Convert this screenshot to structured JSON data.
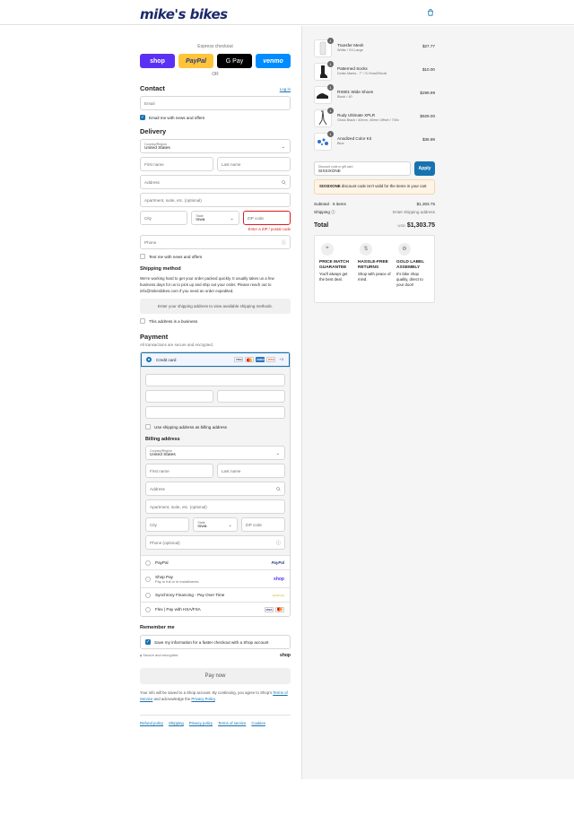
{
  "header": {
    "logo_text": "mike's bikes",
    "cart_icon": "shopping-bag-icon"
  },
  "express": {
    "title": "Express checkout",
    "buttons": [
      "shop",
      "PayPal",
      "G Pay",
      "venmo"
    ],
    "or_text": "OR"
  },
  "contact": {
    "title": "Contact",
    "login_label": "Log in",
    "email_placeholder": "Email",
    "news_label": "Email me with news and offers",
    "news_checked": true
  },
  "delivery": {
    "title": "Delivery",
    "country_label": "Country/Region",
    "country_value": "United States",
    "first_name_placeholder": "First name",
    "last_name_placeholder": "Last name",
    "address_placeholder": "Address",
    "apt_placeholder": "Apartment, suite, etc. (optional)",
    "city_placeholder": "City",
    "state_label": "State",
    "state_value": "Iowa",
    "zip_placeholder": "ZIP code",
    "zip_error": "Enter a ZIP / postal code",
    "phone_placeholder": "Phone",
    "text_label": "Text me with news and offers"
  },
  "shipping": {
    "title": "Shipping method",
    "message": "We're working hard to get your order packed quickly. It usually takes us a few business days for us to pick up and ship out your order. Please reach out to info@mikesbikes.com if you need an order expedited.",
    "placeholder_box": "Enter your shipping address to view available shipping methods.",
    "business_label": "This address is a business"
  },
  "payment": {
    "title": "Payment",
    "subtitle": "All transactions are secure and encrypted.",
    "credit_card_label": "Credit card",
    "card_brands": [
      "VISA",
      "MC",
      "AMEX",
      "DISC"
    ],
    "more_cards": "+3",
    "same_address_label": "Use shipping address as billing address",
    "billing_title": "Billing address",
    "billing": {
      "country_label": "Country/Region",
      "country_value": "United States",
      "first_name_placeholder": "First name",
      "last_name_placeholder": "Last name",
      "address_placeholder": "Address",
      "apt_placeholder": "Apartment, suite, etc. (optional)",
      "city_placeholder": "City",
      "state_label": "State",
      "state_value": "Iowa",
      "zip_placeholder": "ZIP code",
      "phone_placeholder": "Phone (optional)"
    },
    "methods": [
      {
        "label": "PayPal",
        "badge": "PayPal"
      },
      {
        "label": "Shop Pay",
        "sub": "Pay in full or in installments",
        "badge": "shop"
      },
      {
        "label": "Synchrony Financing - Pay Over Time",
        "badge": "synchrony"
      },
      {
        "label": "Flex | Pay with HSA/FSA",
        "badge": "VISA MC"
      }
    ]
  },
  "remember": {
    "title": "Remember me",
    "save_label": "Save my information for a faster checkout with a Shop account",
    "secure_text": "Secure and encrypted",
    "shop_text": "shop"
  },
  "pay_now_label": "Pay now",
  "fine_print": {
    "prefix": "Your info will be saved to a Shop account. By continuing, you agree to Shop's",
    "terms": "Terms of Service",
    "middle": "and acknowledge the",
    "privacy": "Privacy Policy",
    "suffix": "."
  },
  "footer_links": [
    "Refund policy",
    "Shipping",
    "Privacy policy",
    "Terms of service",
    "Cookies"
  ],
  "cart": {
    "items": [
      {
        "name": "Transfer Mesh",
        "variant": "White / XX-Large",
        "price": "$27.77",
        "qty": "1"
      },
      {
        "name": "Patterned Socks",
        "variant": "Dollar Marks - 7\" / S-Small/Small",
        "price": "$10.00",
        "qty": "1"
      },
      {
        "name": "RX801 Wide Shoes",
        "variant": "Black / 40",
        "price": "$299.99",
        "qty": "1"
      },
      {
        "name": "Rudy Ultimate XPLR",
        "variant": "Gloss Black / 40mm, 40mm Offset / 700c",
        "price": "$929.00",
        "qty": "1"
      },
      {
        "name": "Anodized Color Kit",
        "variant": "Blue",
        "price": "$36.99",
        "qty": "1"
      }
    ],
    "discount_label": "Discount code or gift card",
    "discount_value": "SIXSIXONE",
    "apply_label": "Apply",
    "warning_code": "SIXSIXONE",
    "warning_text": "discount code isn't valid for the items in your cart",
    "subtotal_label": "Subtotal · 5 items",
    "subtotal_value": "$1,303.75",
    "shipping_label": "Shipping",
    "shipping_value": "Enter shipping address",
    "total_label": "Total",
    "currency": "USD",
    "total_value": "$1,303.75"
  },
  "benefits": [
    {
      "icon": "tag-icon",
      "title": "PRICE MATCH GUARANTEE",
      "text": "You'll always get the best deal."
    },
    {
      "icon": "return-arrows-icon",
      "title": "HASSLE-FREE RETURNS",
      "text": "Shop with peace of mind."
    },
    {
      "icon": "gear-icon",
      "title": "GOLD LABEL ASSEMBLY",
      "text": "It's bike shop quality, direct to your door!"
    }
  ],
  "colors": {
    "brand": "#1b2a6b",
    "accent": "#1773b0",
    "error": "#dd1d1d"
  }
}
